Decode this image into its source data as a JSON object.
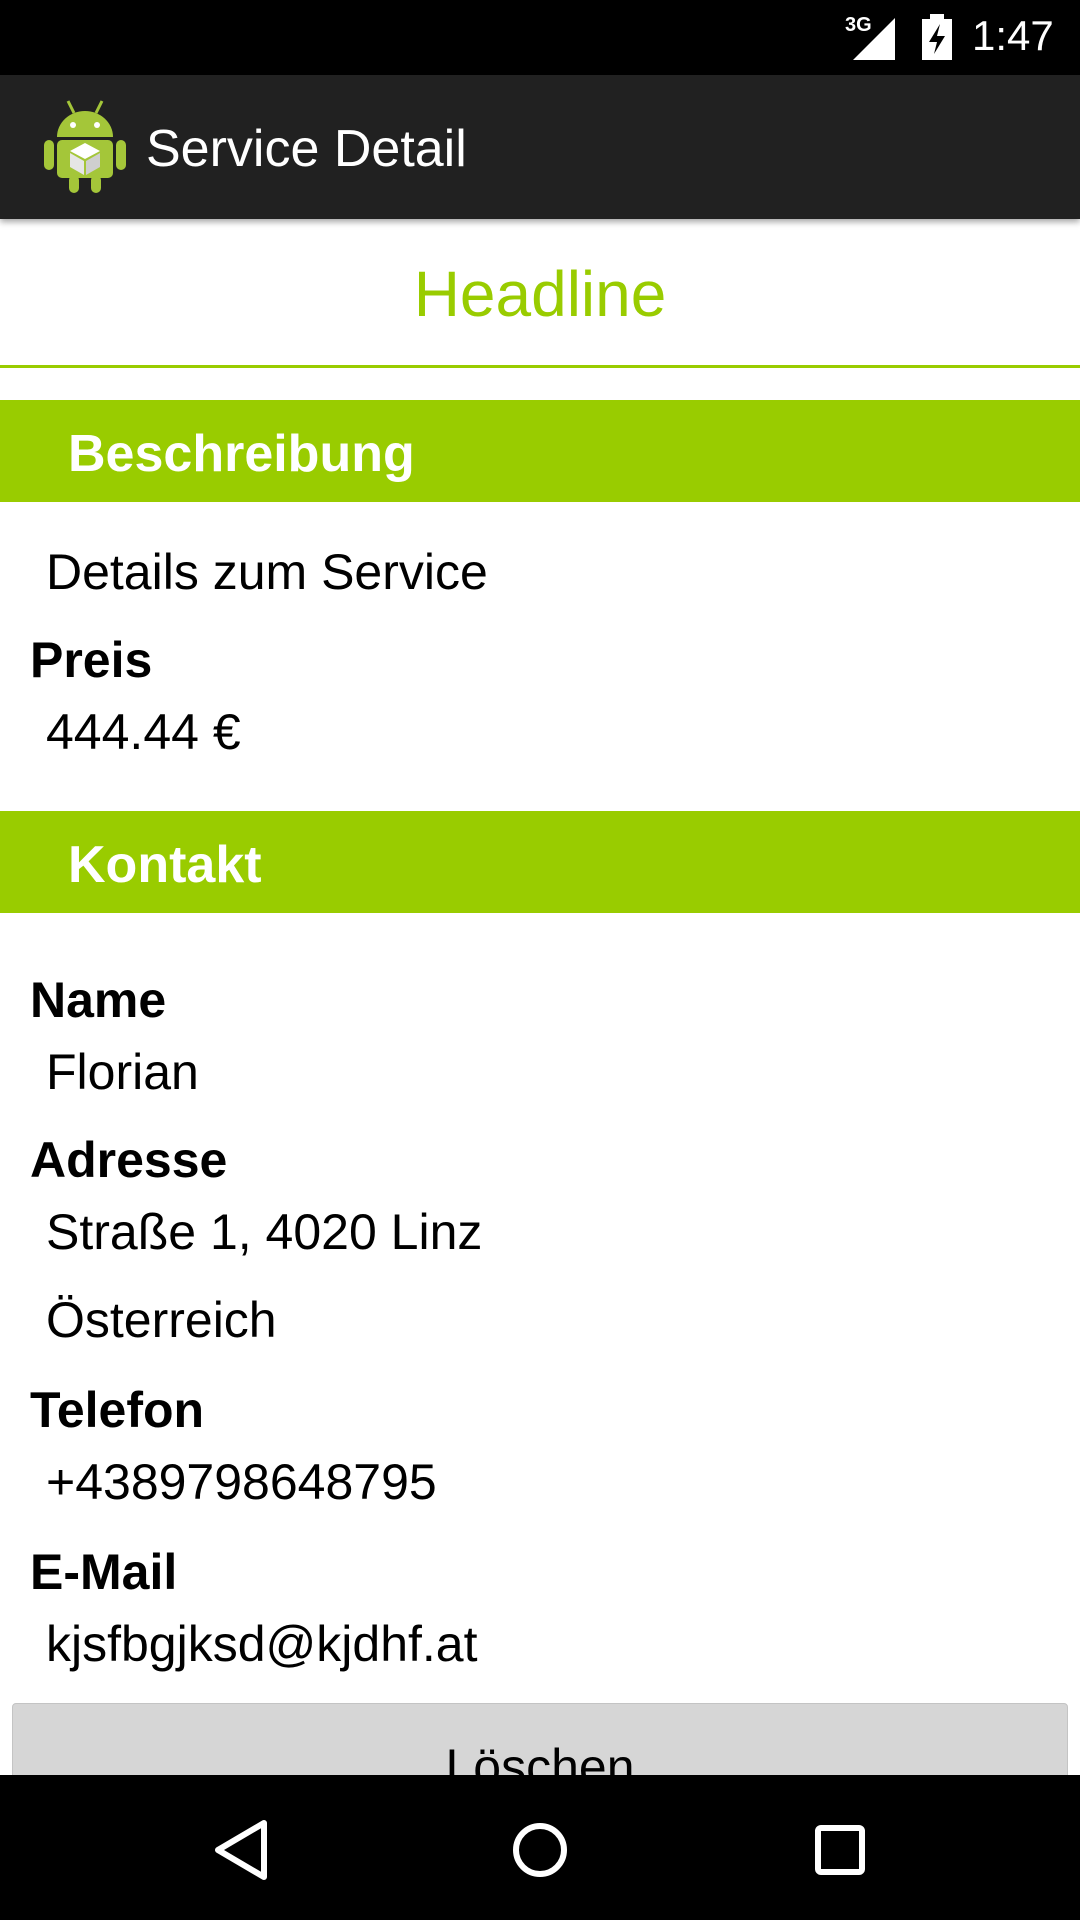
{
  "status_bar": {
    "network_label": "3G",
    "time": "1:47",
    "icons": [
      "signal-icon",
      "battery-charging-icon"
    ]
  },
  "action_bar": {
    "icon": "android-app-icon",
    "title": "Service Detail"
  },
  "detail": {
    "headline": "Headline",
    "description_section": {
      "title": "Beschreibung",
      "description": "Details zum Service",
      "price_label": "Preis",
      "price_value": "444.44 €"
    },
    "contact_section": {
      "title": "Kontakt",
      "name_label": "Name",
      "name_value": "Florian",
      "address_label": "Adresse",
      "address_line1": "Straße 1, 4020 Linz",
      "address_line2": "Österreich",
      "phone_label": "Telefon",
      "phone_value": "+4389798648795",
      "email_label": "E-Mail",
      "email_value": "kjsfbgjksd@kjdhf.at"
    },
    "delete_label": "Löschen"
  },
  "nav_bar": {
    "icons": [
      "back-icon",
      "home-icon",
      "recents-icon"
    ]
  },
  "colors": {
    "accent": "#99cc00",
    "action_bar": "#212121",
    "status_bar": "#000000",
    "button": "#d6d6d6"
  }
}
